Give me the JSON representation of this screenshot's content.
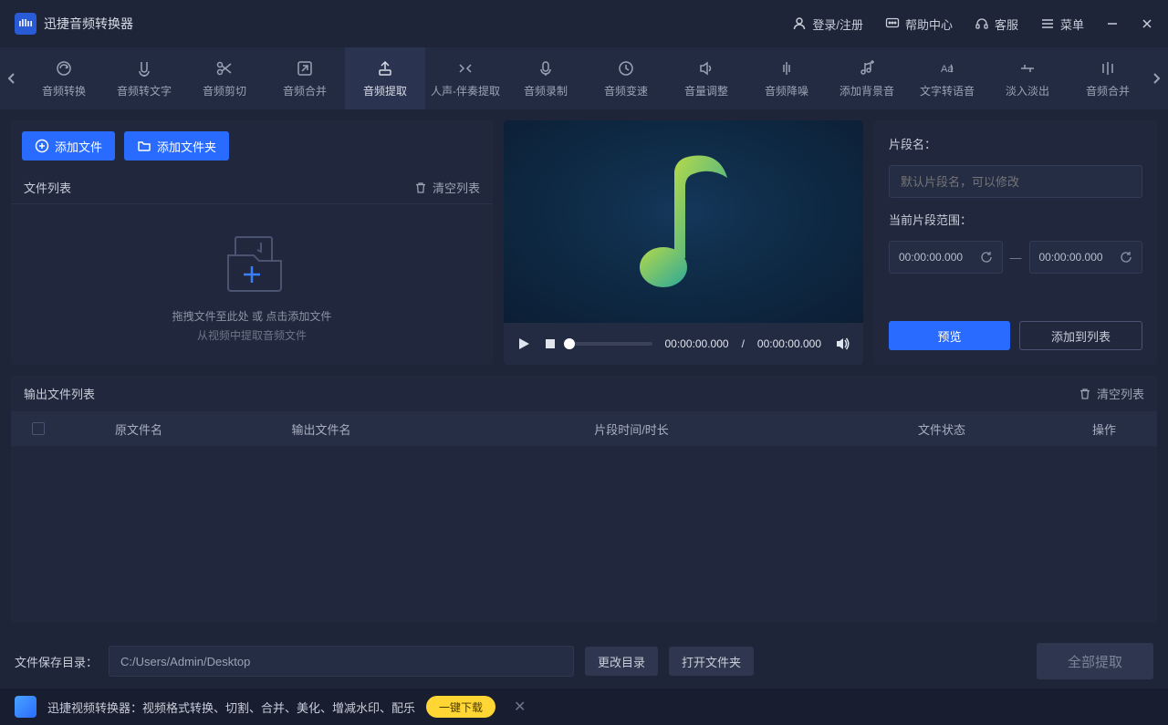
{
  "app": {
    "title": "迅捷音频转换器"
  },
  "titlebar": {
    "login": "登录/注册",
    "help": "帮助中心",
    "service": "客服",
    "menu": "菜单"
  },
  "tabs": [
    {
      "label": "音频转换"
    },
    {
      "label": "音频转文字"
    },
    {
      "label": "音频剪切"
    },
    {
      "label": "音频合并"
    },
    {
      "label": "音频提取",
      "active": true
    },
    {
      "label": "人声-伴奏提取"
    },
    {
      "label": "音频录制"
    },
    {
      "label": "音频变速"
    },
    {
      "label": "音量调整"
    },
    {
      "label": "音频降噪"
    },
    {
      "label": "添加背景音"
    },
    {
      "label": "文字转语音"
    },
    {
      "label": "淡入淡出"
    },
    {
      "label": "音频合并"
    }
  ],
  "leftpane": {
    "add_file": "添加文件",
    "add_folder": "添加文件夹",
    "file_list": "文件列表",
    "clear_list": "清空列表",
    "drop_text1": "拖拽文件至此处 或 点击添加文件",
    "drop_text2": "从视频中提取音频文件"
  },
  "player": {
    "time_current": "00:00:00.000",
    "time_sep": "/",
    "time_total": "00:00:00.000"
  },
  "rightpane": {
    "clip_name_label": "片段名：",
    "clip_name_placeholder": "默认片段名，可以修改",
    "range_label": "当前片段范围：",
    "range_start": "00:00:00.000",
    "range_end": "00:00:00.000",
    "preview_btn": "预览",
    "add_to_list_btn": "添加到列表"
  },
  "outlist": {
    "title": "输出文件列表",
    "clear": "清空列表",
    "cols": {
      "source": "原文件名",
      "output": "输出文件名",
      "clip": "片段时间/时长",
      "status": "文件状态",
      "action": "操作"
    }
  },
  "bottom": {
    "save_label": "文件保存目录：",
    "path": "C:/Users/Admin/Desktop",
    "change_dir": "更改目录",
    "open_folder": "打开文件夹",
    "extract_all": "全部提取"
  },
  "promo": {
    "text": "迅捷视频转换器：视频格式转换、切割、合并、美化、增减水印、配乐",
    "btn": "一键下载"
  }
}
